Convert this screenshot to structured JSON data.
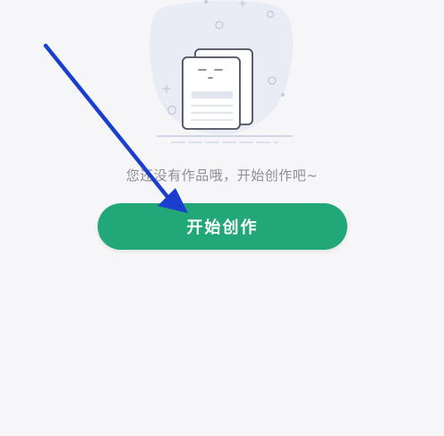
{
  "empty_state": {
    "illustration_icon": "empty-documents-icon",
    "message": "您还没有作品哦，开始创作吧~",
    "start_button_label": "开始创作"
  },
  "annotation": {
    "icon": "arrow-pointer-icon",
    "color": "#1a3fcf"
  },
  "colors": {
    "background": "#f6f6f9",
    "primary_button": "#22a878",
    "message_text": "#8e8e96"
  }
}
